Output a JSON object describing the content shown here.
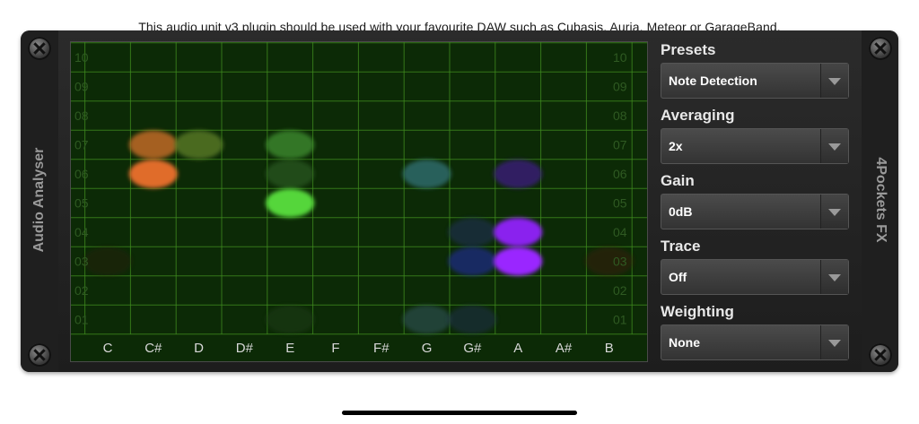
{
  "top_note": "This audio unit v3 plugin should be used with your favourite DAW such as Cubasis, Auria, Meteor or GarageBand.",
  "left_label": "Audio Analyser",
  "right_label": "4Pockets FX",
  "grid": {
    "rows": [
      "10",
      "09",
      "08",
      "07",
      "06",
      "05",
      "04",
      "03",
      "02",
      "01"
    ],
    "notes": [
      "C",
      "C#",
      "D",
      "D#",
      "E",
      "F",
      "F#",
      "G",
      "G#",
      "A",
      "A#",
      "B"
    ],
    "colors": {
      "background": "#0c2a06",
      "grid_line": "#3e8a1e",
      "label": "#2f5a22",
      "note_label": "#d8d8d8"
    },
    "blobs": [
      {
        "note": "C#",
        "octave": 7,
        "color": "#c06a25",
        "opacity": 0.85
      },
      {
        "note": "C#",
        "octave": 6,
        "color": "#e06c2a",
        "opacity": 1.0
      },
      {
        "note": "D",
        "octave": 7,
        "color": "#5a7a28",
        "opacity": 0.8
      },
      {
        "note": "E",
        "octave": 7,
        "color": "#3e8a2e",
        "opacity": 0.8
      },
      {
        "note": "E",
        "octave": 6,
        "color": "#2c5a20",
        "opacity": 0.7
      },
      {
        "note": "E",
        "octave": 5,
        "color": "#55d63a",
        "opacity": 1.0
      },
      {
        "note": "E",
        "octave": 1,
        "color": "#1e3a18",
        "opacity": 0.6
      },
      {
        "note": "G",
        "octave": 6,
        "color": "#2e6a6a",
        "opacity": 0.85
      },
      {
        "note": "G",
        "octave": 1,
        "color": "#2a4e4e",
        "opacity": 0.7
      },
      {
        "note": "G#",
        "octave": 4,
        "color": "#1c2e4a",
        "opacity": 0.7
      },
      {
        "note": "G#",
        "octave": 3,
        "color": "#1a2a7a",
        "opacity": 0.8
      },
      {
        "note": "G#",
        "octave": 1,
        "color": "#1e2e44",
        "opacity": 0.6
      },
      {
        "note": "A",
        "octave": 6,
        "color": "#3a1a7a",
        "opacity": 0.8
      },
      {
        "note": "A",
        "octave": 4,
        "color": "#8a22ee",
        "opacity": 1.0
      },
      {
        "note": "A",
        "octave": 3,
        "color": "#9a26ff",
        "opacity": 1.0
      },
      {
        "note": "B",
        "octave": 3,
        "color": "#3a1a10",
        "opacity": 0.5
      },
      {
        "note": "C",
        "octave": 3,
        "color": "#2a1a0e",
        "opacity": 0.4
      }
    ]
  },
  "controls": [
    {
      "label": "Presets",
      "value": "Note Detection"
    },
    {
      "label": "Averaging",
      "value": "2x"
    },
    {
      "label": "Gain",
      "value": "0dB"
    },
    {
      "label": "Trace",
      "value": "Off"
    },
    {
      "label": "Weighting",
      "value": "None"
    }
  ]
}
